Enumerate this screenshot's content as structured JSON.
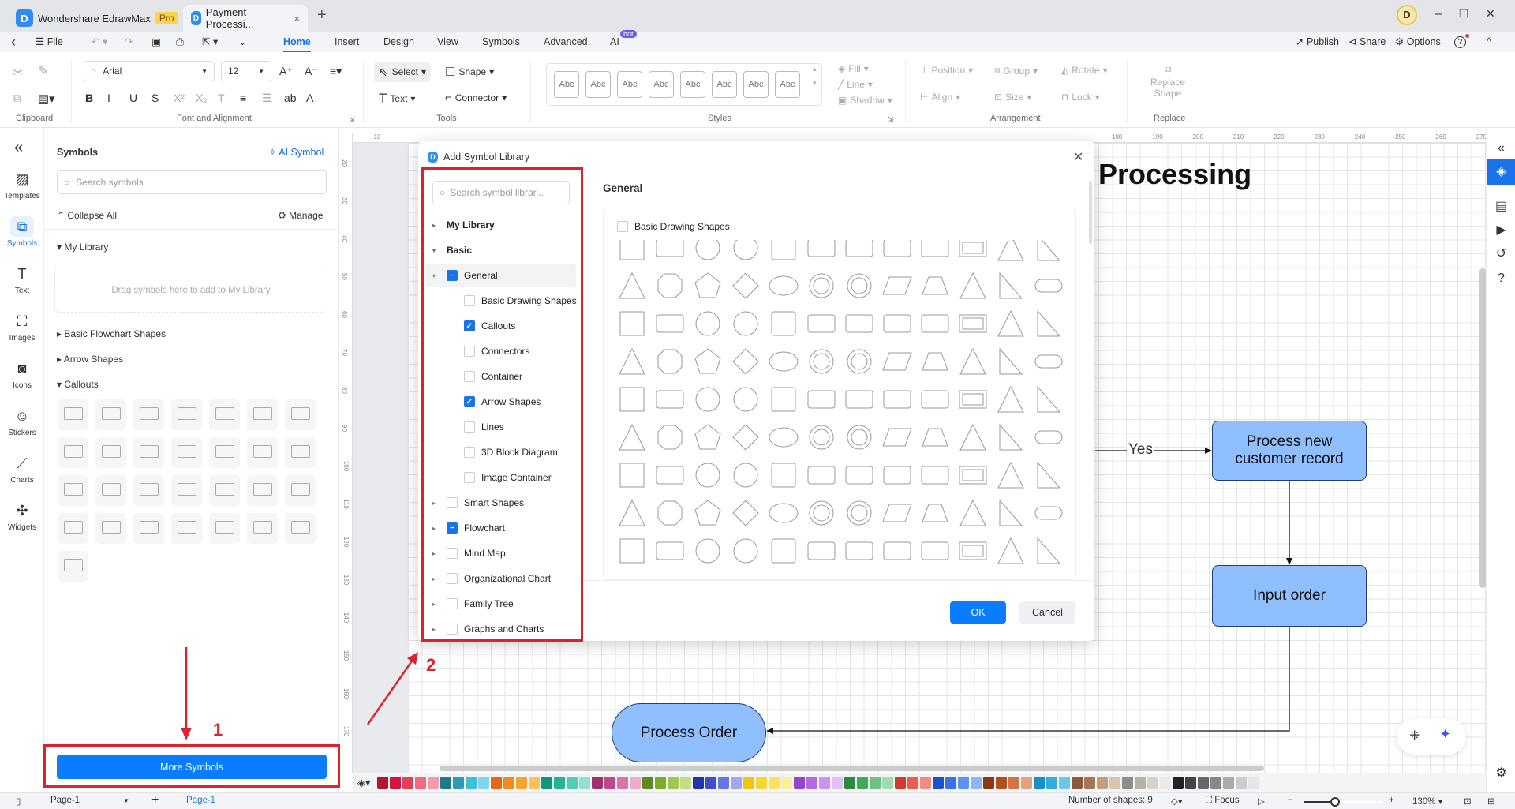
{
  "tabs": [
    {
      "label": "Wondershare EdrawMax",
      "badge": "Pro"
    },
    {
      "label": "Payment Processi...",
      "close": "×"
    }
  ],
  "window": {
    "add_tab": "+",
    "avatar": "D",
    "minimize": "–",
    "restore": "❐",
    "close": "✕"
  },
  "menu": {
    "back": "‹",
    "file": "File",
    "items": [
      "Home",
      "Insert",
      "Design",
      "View",
      "Symbols",
      "Advanced",
      "AI"
    ],
    "ai_badge": "hot",
    "publish": "Publish",
    "share": "Share",
    "options": "Options",
    "help": "?",
    "collapse": "^"
  },
  "ribbon": {
    "font": "Arial",
    "size": "12",
    "select": "Select",
    "shape": "Shape",
    "text": "Text",
    "connector": "Connector",
    "style_sample": "Abc",
    "fill": "Fill",
    "line": "Line",
    "shadow": "Shadow",
    "position": "Position",
    "group": "Group",
    "rotate": "Rotate",
    "align": "Align",
    "sizebtn": "Size",
    "lock": "Lock",
    "replace_shape": "Replace Shape",
    "groups": [
      "Clipboard",
      "Font and Alignment",
      "Tools",
      "Styles",
      "Arrangement",
      "Replace"
    ],
    "format": [
      "B",
      "I",
      "U",
      "S",
      "X²",
      "X₂",
      "T",
      "≡",
      "☰",
      "ab",
      "A"
    ]
  },
  "rail": [
    {
      "label": "Templates",
      "icon": "templates-icon"
    },
    {
      "label": "Symbols",
      "icon": "symbols-icon"
    },
    {
      "label": "Text",
      "icon": "text-icon"
    },
    {
      "label": "Images",
      "icon": "images-icon"
    },
    {
      "label": "Icons",
      "icon": "icons-icon"
    },
    {
      "label": "Stickers",
      "icon": "stickers-icon"
    },
    {
      "label": "Charts",
      "icon": "charts-icon"
    },
    {
      "label": "Widgets",
      "icon": "widgets-icon"
    }
  ],
  "symbols": {
    "title": "Symbols",
    "ai_symbol": "AI Symbol",
    "search_placeholder": "Search symbols",
    "collapse_all": "Collapse All",
    "manage": "Manage",
    "my_library": "My Library",
    "drop_hint": "Drag symbols here to add to My Library",
    "sections": [
      "Basic Flowchart Shapes",
      "Arrow Shapes",
      "Callouts"
    ],
    "more_symbols": "More Symbols"
  },
  "dialog": {
    "title": "Add Symbol Library",
    "search_placeholder": "Search symbol librar...",
    "my_library": "My Library",
    "basic": "Basic",
    "tree": [
      {
        "label": "General",
        "state": "partial",
        "level": 1,
        "caret": "▾"
      },
      {
        "label": "Basic Drawing Shapes",
        "state": "off",
        "level": 2
      },
      {
        "label": "Callouts",
        "state": "on",
        "level": 2
      },
      {
        "label": "Connectors",
        "state": "off",
        "level": 2
      },
      {
        "label": "Container",
        "state": "off",
        "level": 2
      },
      {
        "label": "Arrow Shapes",
        "state": "on",
        "level": 2
      },
      {
        "label": "Lines",
        "state": "off",
        "level": 2
      },
      {
        "label": "3D Block Diagram",
        "state": "off",
        "level": 2
      },
      {
        "label": "Image Container",
        "state": "off",
        "level": 2
      },
      {
        "label": "Smart Shapes",
        "state": "off",
        "level": 1,
        "caret": "▸"
      },
      {
        "label": "Flowchart",
        "state": "partial",
        "level": 1,
        "caret": "▸"
      },
      {
        "label": "Mind Map",
        "state": "off",
        "level": 1,
        "caret": "▸"
      },
      {
        "label": "Organizational Chart",
        "state": "off",
        "level": 1,
        "caret": "▸"
      },
      {
        "label": "Family Tree",
        "state": "off",
        "level": 1,
        "caret": "▸"
      },
      {
        "label": "Graphs and Charts",
        "state": "off",
        "level": 1,
        "caret": "▸"
      }
    ],
    "section_title": "General",
    "section_checkbox": "Basic Drawing Shapes",
    "ok": "OK",
    "cancel": "Cancel"
  },
  "diagram": {
    "title": "Processing",
    "yes": "Yes",
    "node1": "Process new customer record",
    "node2": "Input order",
    "node3": "Process Order"
  },
  "annotations": {
    "step1": "1",
    "step2": "2"
  },
  "ruler_top": [
    "-10",
    "180",
    "190",
    "200",
    "210",
    "220",
    "230",
    "240",
    "250",
    "260",
    "270"
  ],
  "ruler_left": [
    "20",
    "30",
    "40",
    "50",
    "60",
    "70",
    "80",
    "90",
    "100",
    "110",
    "120",
    "130",
    "140",
    "150",
    "160",
    "170"
  ],
  "status": {
    "page_select": "Page-1",
    "add_page": "+",
    "page_tab": "Page-1",
    "shapes": "Number of shapes: 9",
    "focus": "Focus",
    "zoom": "130%"
  },
  "colors": {
    "accent": "#1a73e8",
    "node_fill": "#8fbfff",
    "annotation": "#e0212b",
    "palette": [
      "#b5162b",
      "#d3163a",
      "#e43f5a",
      "#ee6b82",
      "#f59aae",
      "#1f7a8c",
      "#2a9db5",
      "#3cc0d8",
      "#7fd6e6",
      "#e8651a",
      "#f28a1c",
      "#f7a531",
      "#fbc160",
      "#109678",
      "#1fb597",
      "#50cdb2",
      "#92e0cf",
      "#a0316f",
      "#c0478d",
      "#db72ab",
      "#eeaccd",
      "#5b8b1f",
      "#7cac2c",
      "#9dc84a",
      "#c3de86",
      "#2136a8",
      "#3b4fd0",
      "#6875e6",
      "#9ea7f0",
      "#f1c40f",
      "#f7d532",
      "#f9e35c",
      "#fbef99",
      "#9245c7",
      "#b26ae0",
      "#cc95ec",
      "#e1c1f5",
      "#2b8a3e",
      "#3faa5a",
      "#69c37d",
      "#a2dbaf",
      "#d43a32",
      "#ee5b51",
      "#f48b83",
      "#1f4fd1",
      "#3571f0",
      "#5c91f5",
      "#8fb5fa",
      "#8c3a12",
      "#b1501e",
      "#d47343",
      "#e9a080",
      "#1b90c7",
      "#35acdf",
      "#70c6ea",
      "#8a5a3c",
      "#a67654",
      "#c29d7f",
      "#dbc4b0",
      "#8f8f86",
      "#b3b3a8",
      "#d4d4ca",
      "#ecebe3",
      "#222222",
      "#444444",
      "#666666",
      "#888888",
      "#aaaaaa",
      "#cccccc",
      "#e6e6e6"
    ]
  }
}
